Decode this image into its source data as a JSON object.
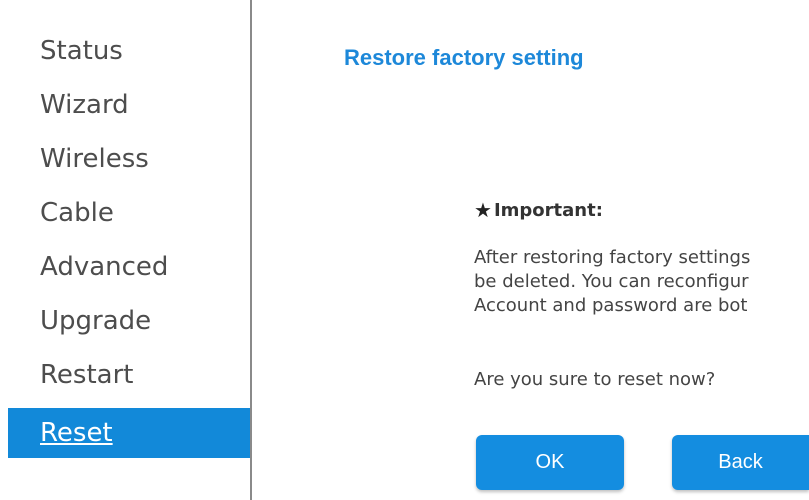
{
  "sidebar": {
    "items": [
      {
        "label": "Status"
      },
      {
        "label": "Wizard"
      },
      {
        "label": "Wireless"
      },
      {
        "label": "Cable"
      },
      {
        "label": "Advanced"
      },
      {
        "label": "Upgrade"
      },
      {
        "label": "Restart"
      }
    ],
    "active_label": "Reset"
  },
  "main": {
    "title": "Restore factory setting",
    "important_label": "Important:",
    "message_lines": [
      "After restoring factory settings",
      "be deleted. You can reconfigur",
      "Account and password are bot"
    ],
    "question": "Are you sure to reset now?",
    "ok_label": "OK",
    "back_label": "Back"
  },
  "colors": {
    "accent": "#1289d9",
    "title": "#1d88d9"
  }
}
